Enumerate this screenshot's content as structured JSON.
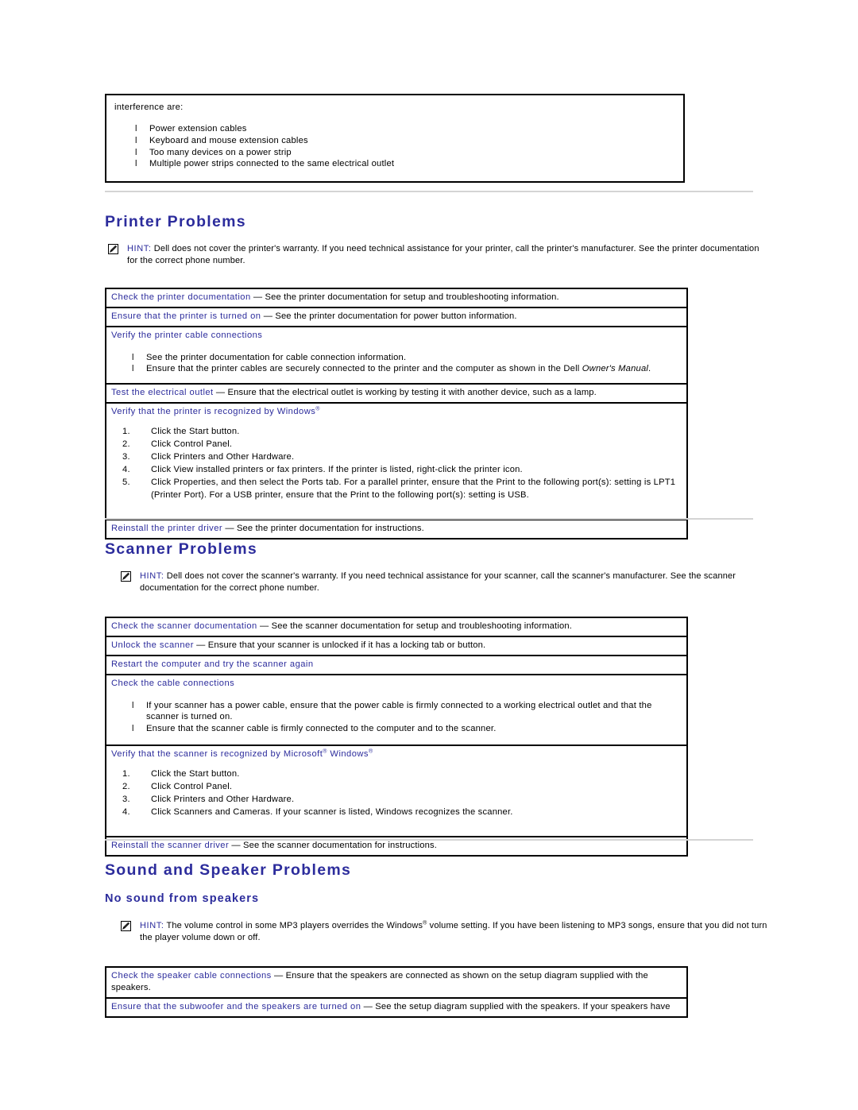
{
  "document": {
    "title": "Dell Troubleshooting — Printer, Scanner, Sound and Speaker Problems",
    "heading_color": "#2c2c9c",
    "rule_color": "#d4d4d4",
    "border_color": "#000000"
  },
  "top_box": {
    "intro": "interference are:",
    "bullets": [
      "Power extension cables",
      "Keyboard and mouse extension cables",
      "Too many devices on a power strip",
      "Multiple power strips connected to the same electrical outlet"
    ]
  },
  "printer": {
    "heading": "Printer Problems",
    "hint": {
      "label": "HINT:",
      "text": "Dell does not cover the printer's warranty. If you need technical assistance for your printer, call the printer's manufacturer. See the printer documentation for the correct phone number."
    },
    "rows": {
      "check_doc_lead": "Check the printer documentation",
      "check_doc_dash": " — ",
      "check_doc_body": "See the printer documentation for setup and troubleshooting information.",
      "turned_on_lead": "Ensure that the printer is turned on",
      "turned_on_dash": " — ",
      "turned_on_body": "See the printer documentation for power button information.",
      "cable_lead": "Verify the printer cable connections",
      "cable_bullets": [
        "See the printer documentation for cable connection information.",
        "Ensure that the printer cables are securely connected to the printer and the computer as shown in the Dell Owner's Manual."
      ],
      "cable_bullet2_plain": "Ensure that the printer cables are securely connected to the printer and the computer as shown in the Dell ",
      "cable_bullet2_italic": "Owner's Manual",
      "cable_bullet2_tail": ".",
      "outlet_lead": "Test the electrical outlet",
      "outlet_dash": " — ",
      "outlet_body": "Ensure that the electrical outlet is working by testing it with another device, such as a lamp.",
      "recognized_lead": "Verify that the printer is recognized by Windows",
      "recognized_steps": [
        "Click the Start button.",
        "Click Control Panel.",
        "Click Printers and Other Hardware.",
        "Click View installed printers or fax printers. If the printer is listed, right-click the printer icon.",
        "Click Properties, and then select the Ports tab. For a parallel printer, ensure that the Print to the following port(s): setting is LPT1 (Printer Port). For a USB printer, ensure that the Print to the following port(s): setting is USB."
      ],
      "reinstall_lead": "Reinstall the printer driver",
      "reinstall_dash": " — ",
      "reinstall_body": "See the printer documentation for instructions."
    }
  },
  "scanner": {
    "heading": "Scanner Problems",
    "hint": {
      "label": "HINT:",
      "text": "Dell does not cover the scanner's warranty. If you need technical assistance for your scanner, call the scanner's manufacturer. See the scanner documentation for the correct phone number."
    },
    "rows": {
      "check_doc_lead": "Check the scanner documentation",
      "check_doc_dash": " — ",
      "check_doc_body": "See the scanner documentation for setup and troubleshooting information.",
      "unlock_lead": "Unlock the scanner",
      "unlock_dash": " — ",
      "unlock_body": "Ensure that your scanner is unlocked if it has a locking tab or button.",
      "restart_lead": "Restart the computer and try the scanner again",
      "cable_lead": "Check the cable connections",
      "cable_bullets": [
        "If your scanner has a power cable, ensure that the power cable is firmly connected to a working electrical outlet and that the scanner is turned on.",
        "Ensure that the scanner cable is firmly connected to the computer and to the scanner."
      ],
      "recognized_lead_a": "Verify that the scanner is recognized by Microsoft",
      "recognized_lead_b": " Windows",
      "recognized_steps": [
        "Click the Start button.",
        "Click Control Panel.",
        "Click Printers and Other Hardware.",
        "Click Scanners and Cameras. If your scanner is listed, Windows recognizes the scanner."
      ],
      "reinstall_lead": "Reinstall the scanner driver",
      "reinstall_dash": " — ",
      "reinstall_body": "See the scanner documentation for instructions."
    }
  },
  "sound": {
    "heading": "Sound and Speaker Problems",
    "subheading": "No sound from speakers",
    "hint": {
      "label": "HINT:",
      "text_before": "The volume control in some MP3 players overrides the Windows",
      "text_after": " volume setting. If you have been listening to MP3 songs, ensure that you did not turn the player volume down or off."
    },
    "rows": {
      "speaker_cable_lead": "Check the speaker cable connections",
      "speaker_cable_dash": " — ",
      "speaker_cable_body": "Ensure that the speakers are connected as shown on the setup diagram supplied with the speakers.",
      "subwoofer_lead": "Ensure that the subwoofer and the speakers are turned on",
      "subwoofer_dash": " — ",
      "subwoofer_body": "See the setup diagram supplied with the speakers. If your speakers have"
    }
  },
  "symbols": {
    "registered": "®",
    "bullet": "l",
    "em_dash": "—"
  }
}
